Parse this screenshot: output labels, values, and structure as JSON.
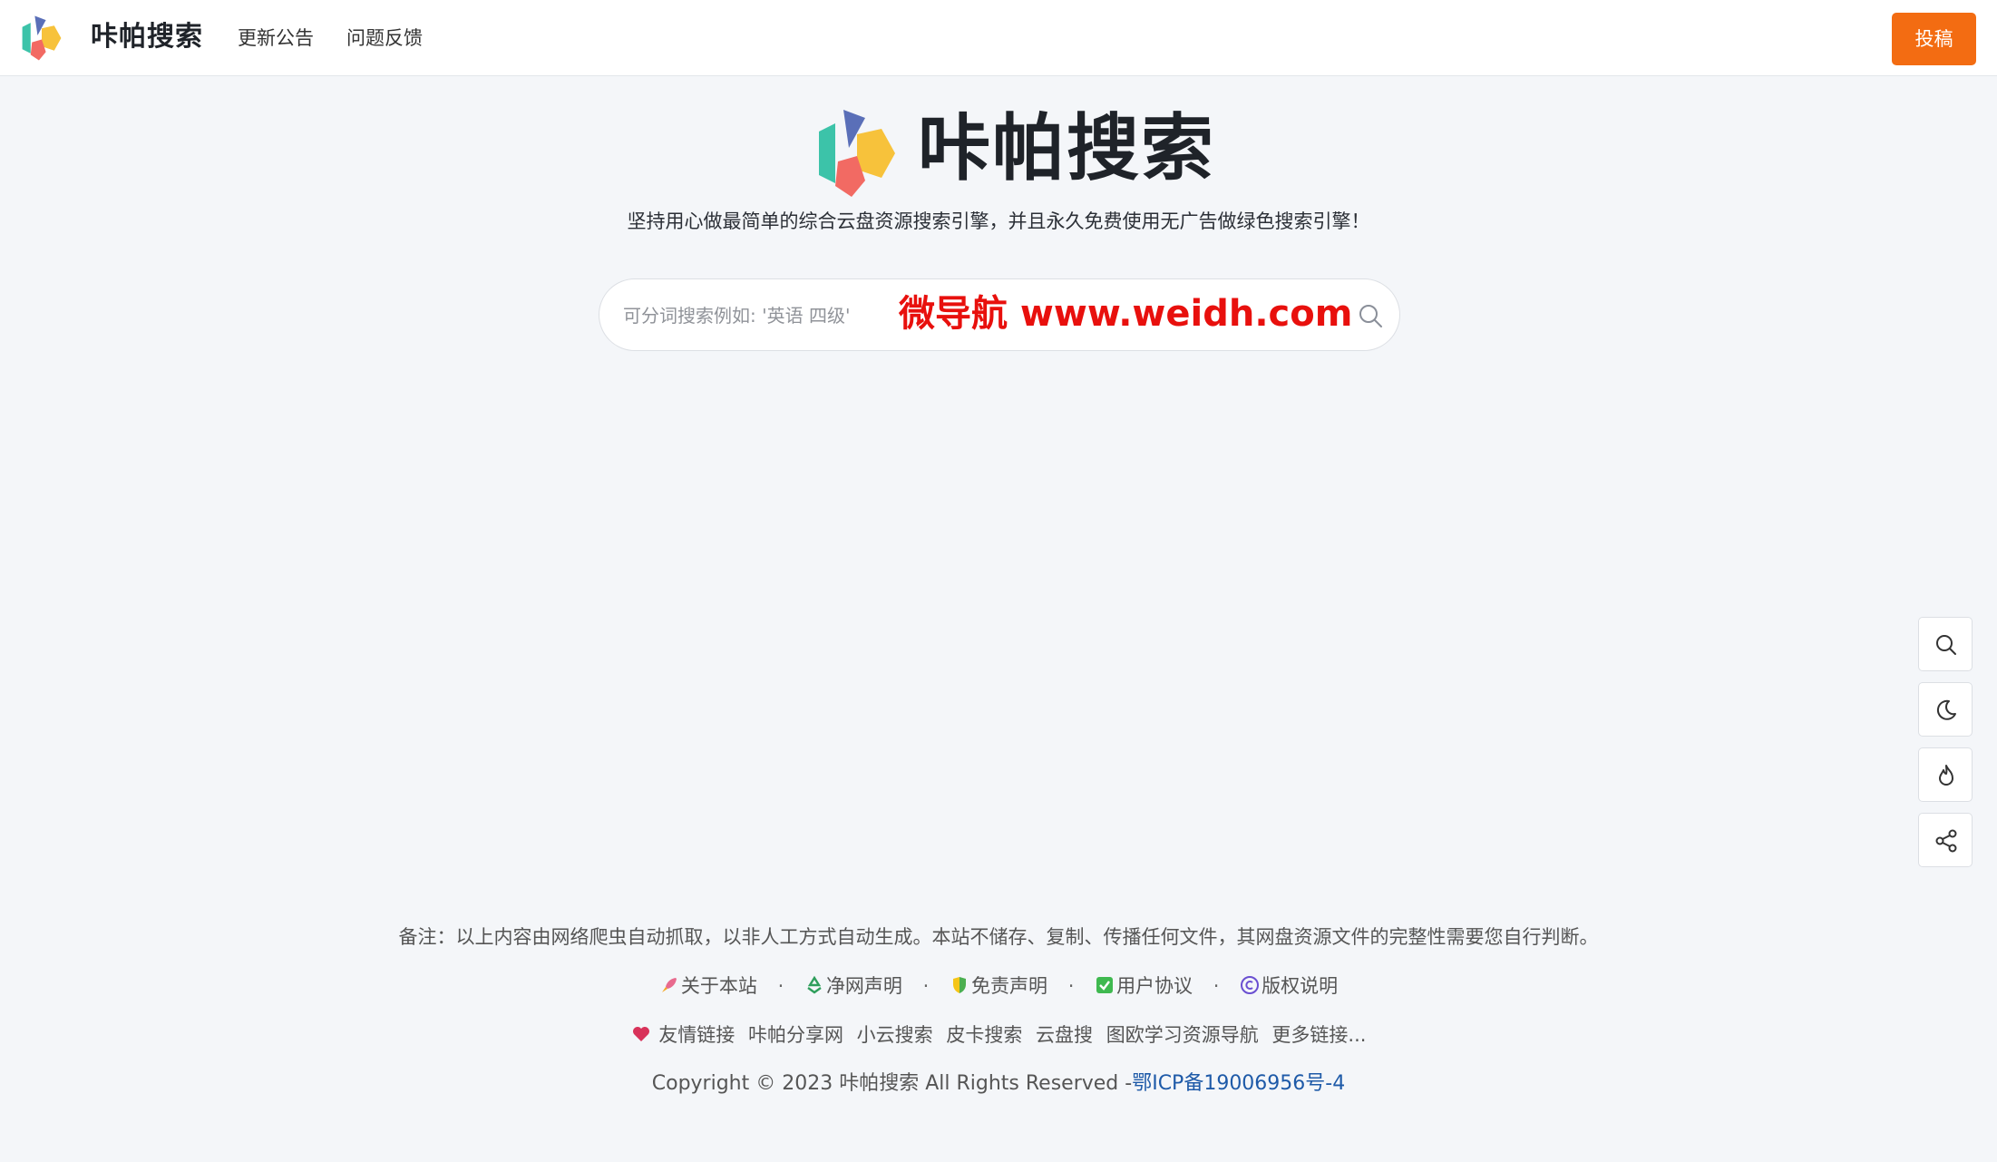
{
  "header": {
    "brand": "咔帕搜索",
    "nav": [
      "更新公告",
      "问题反馈"
    ],
    "submit_label": "投稿"
  },
  "hero": {
    "title": "咔帕搜索",
    "subtitle": "坚持用心做最简单的综合云盘资源搜索引擎，并且永久免费使用无广告做绿色搜索引擎！"
  },
  "search": {
    "placeholder": "可分词搜索例如: '英语 四级'",
    "watermark": "微导航 www.weidh.com"
  },
  "footer": {
    "note": "备注：以上内容由网络爬虫自动抓取，以非人工方式自动生成。本站不储存、复制、传播任何文件，其网盘资源文件的完整性需要您自行判断。",
    "links": [
      "关于本站",
      "净网声明",
      "免责声明",
      "用户协议",
      "版权说明"
    ],
    "friends_label": "友情链接",
    "friends": [
      "咔帕分享网",
      "小云搜索",
      "皮卡搜索",
      "云盘搜",
      "图欧学习资源导航",
      "更多链接..."
    ],
    "copyright": "Copyright © 2023 咔帕搜索 All Rights Reserved -",
    "icp": "鄂ICP备19006956号-4"
  },
  "icons": {
    "logo": "brand-k-logo-icon",
    "search": "search-icon",
    "theme": "moon-icon",
    "hot": "flame-icon",
    "share": "share-icon",
    "about": "rocket-icon",
    "clean": "recycle-icon",
    "disclaimer": "shield-icon",
    "agreement": "check-box-icon",
    "copyright": "copyright-icon",
    "friends": "heart-icon"
  },
  "colors": {
    "accent": "#f36c12",
    "watermark": "#e8100d",
    "icp_link": "#1e5aa8"
  }
}
